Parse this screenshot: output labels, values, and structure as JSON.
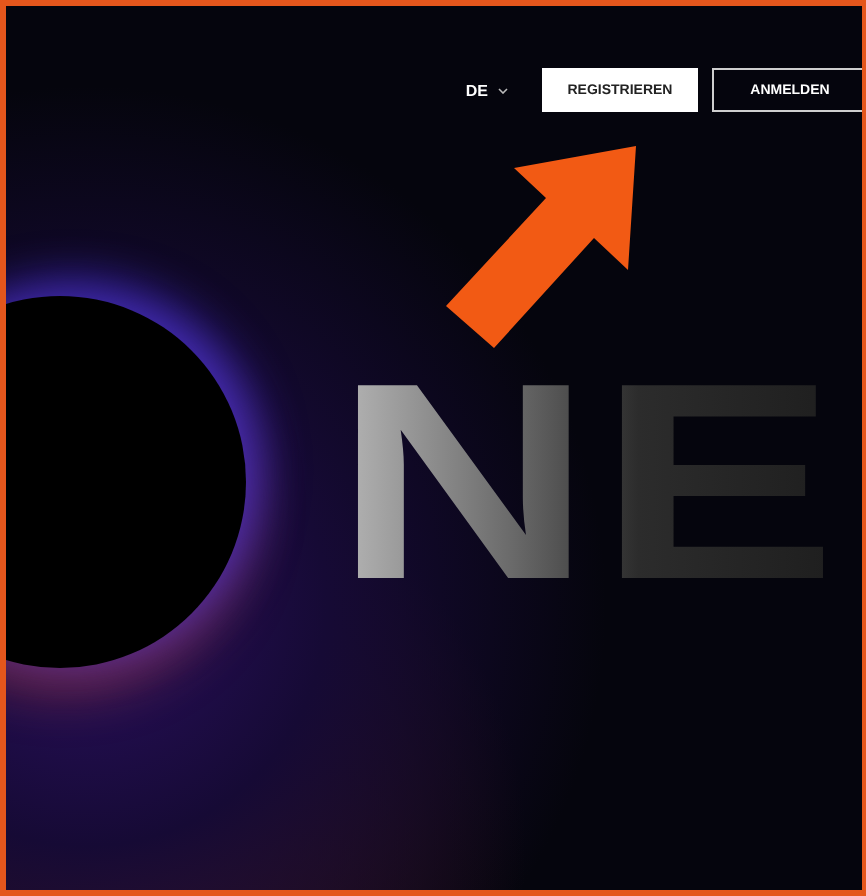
{
  "header": {
    "language": "DE",
    "buttons": [
      {
        "label": "REGISTRIEREN",
        "kind": "primary"
      },
      {
        "label": "ANMELDEN",
        "kind": "outline"
      }
    ]
  },
  "hero": {
    "title": "NE"
  }
}
